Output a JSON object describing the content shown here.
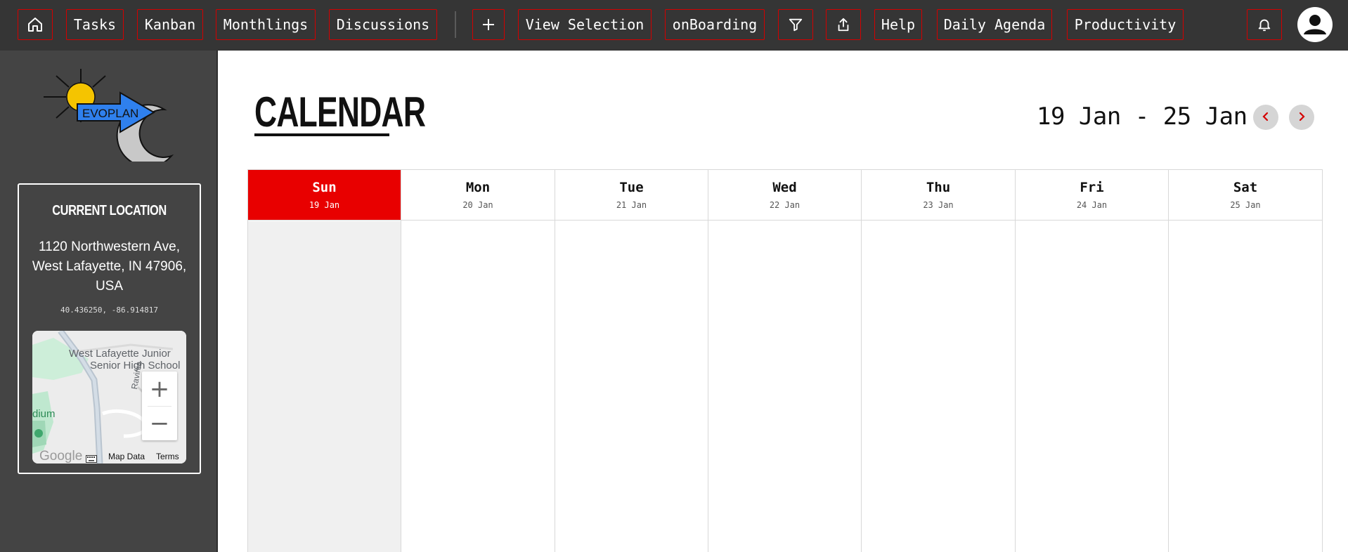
{
  "nav": {
    "tasks": "Tasks",
    "kanban": "Kanban",
    "monthlings": "Monthlings",
    "discussions": "Discussions",
    "view_selection": "View Selection",
    "onboarding": "onBoarding",
    "help": "Help",
    "daily_agenda": "Daily Agenda",
    "productivity": "Productivity",
    "icons": [
      "home-icon",
      "plus-icon",
      "filter-icon",
      "share-icon",
      "bell-icon",
      "user-icon"
    ]
  },
  "sidebar": {
    "logo_text": "EVOPLAN",
    "location": {
      "title": "CURRENT LOCATION",
      "address": "1120 Northwestern Ave, West Lafayette, IN 47906, USA",
      "coords": "40.436250, -86.914817"
    },
    "map": {
      "school_label_1": "West Lafayette Junior",
      "school_label_2": "Senior High School",
      "street_label": "Ravinia",
      "stadium_label": "dium",
      "brand": "Google",
      "map_data": "Map Data",
      "terms": "Terms",
      "zoom_in": "+",
      "zoom_out": "−"
    }
  },
  "calendar": {
    "title": "CALENDAR",
    "range": "19 Jan - 25 Jan",
    "days": [
      {
        "name": "Sun",
        "date": "19 Jan"
      },
      {
        "name": "Mon",
        "date": "20 Jan"
      },
      {
        "name": "Tue",
        "date": "21 Jan"
      },
      {
        "name": "Wed",
        "date": "22 Jan"
      },
      {
        "name": "Thu",
        "date": "23 Jan"
      },
      {
        "name": "Fri",
        "date": "24 Jan"
      },
      {
        "name": "Sat",
        "date": "25 Jan"
      }
    ]
  },
  "colors": {
    "accent": "#e80000",
    "nav_bg": "#353535",
    "sidebar_bg": "#444444",
    "today_column": "#f0f0f0"
  }
}
